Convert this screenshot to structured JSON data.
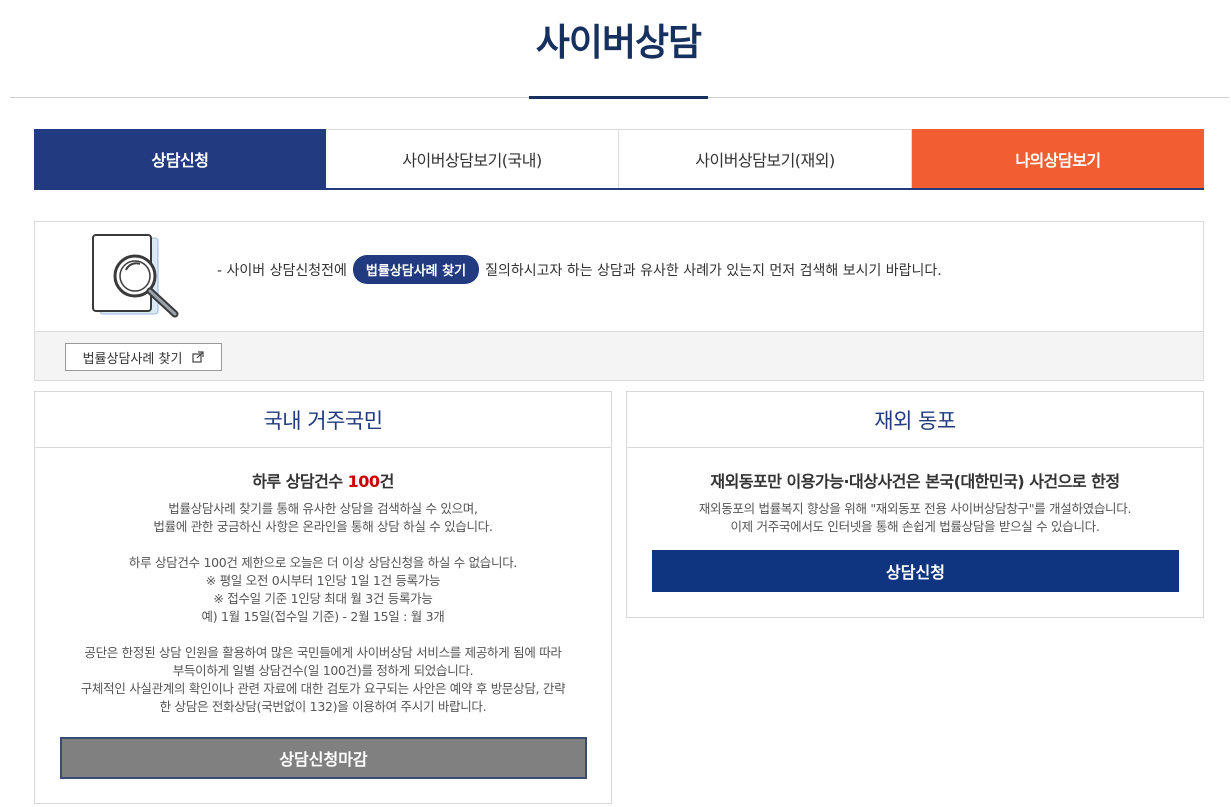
{
  "page": {
    "title": "사이버상담"
  },
  "tabs": [
    {
      "label": "상담신청"
    },
    {
      "label": "사이버상담보기(국내)"
    },
    {
      "label": "사이버상담보기(재외)"
    },
    {
      "label": "나의상담보기"
    }
  ],
  "notice": {
    "text_before": "- 사이버 상담신청전에",
    "pill_label": "법률상담사례 찾기",
    "text_after": "질의하시고자 하는 상담과 유사한 사례가 있는지 먼저 검색해 보시기 바랍니다.",
    "find_button_label": "법률상담사례 찾기"
  },
  "domestic": {
    "heading": "국내 거주국민",
    "subtitle_prefix": "하루 상담건수 ",
    "subtitle_count": "100",
    "subtitle_suffix": "건",
    "para1": [
      "법률상담사례 찾기를 통해 유사한 상담을 검색하실 수 있으며,",
      "법률에 관한 궁금하신 사항은 온라인을 통해 상담 하실 수 있습니다."
    ],
    "para2": [
      "하루 상담건수 100건 제한으로 오늘은 더 이상 상담신청을 하실 수 없습니다.",
      "※ 평일 오전 0시부터 1인당 1일 1건 등록가능",
      "※ 접수일 기준 1인당 최대 월 3건 등록가능",
      "예) 1월 15일(접수일 기준) - 2월 15일 : 월 3개"
    ],
    "para3": [
      "공단은 한정된 상담 인원을 활용하여 많은 국민들에게 사이버상담 서비스를 제공하게 됨에 따라",
      "부득이하게 일별 상담건수(일 100건)를 정하게 되었습니다.",
      "구체적인 사실관계의 확인이나 관련 자료에 대한 검토가 요구되는 사안은 예약 후 방문상담, 간략",
      "한 상담은 전화상담(국번없이 132)을 이용하여 주시기 바랍니다."
    ],
    "button_label": "상담신청마감"
  },
  "overseas": {
    "heading": "재외 동포",
    "subtitle": "재외동포만 이용가능·대상사건은 본국(대한민국) 사건으로 한정",
    "para1": [
      "재외동포의 법률복지 향상을 위해 \"재외동포 전용 사이버상담창구\"를 개설하였습니다.",
      "이제 거주국에서도 인터넷을 통해 손쉽게 법률상담을 받으실 수 있습니다."
    ],
    "button_label": "상담신청"
  }
}
